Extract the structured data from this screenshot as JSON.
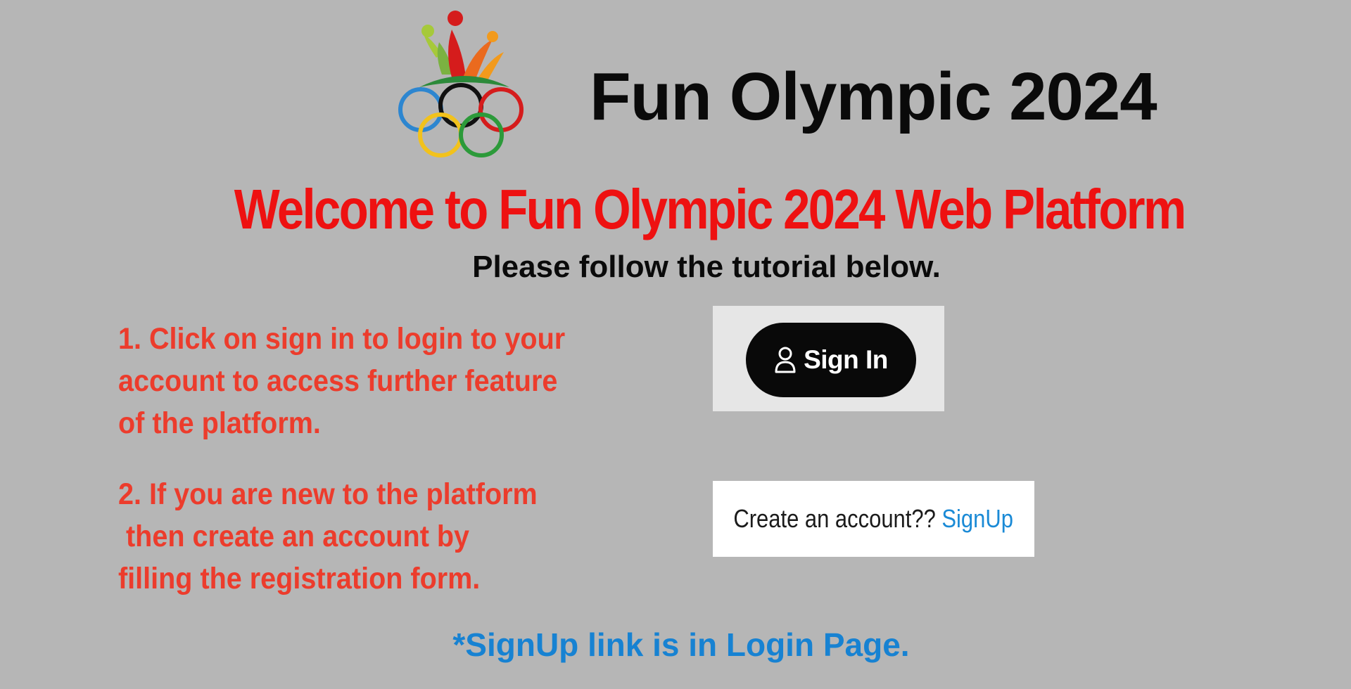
{
  "header": {
    "logo_icon": "olympic-rings-people-logo",
    "title": "Fun Olympic 2024"
  },
  "welcome": {
    "heading": "Welcome to Fun Olympic 2024 Web Platform",
    "subheading": "Please follow the tutorial below."
  },
  "steps": [
    {
      "text": "1. Click on sign in to login to your\naccount to access further feature\nof the platform."
    },
    {
      "text": "2. If you are new to the platform\n then create an account by\nfilling the registration form."
    }
  ],
  "signin_example": {
    "icon": "user-icon",
    "label": "Sign In"
  },
  "signup_example": {
    "prompt": "Create an account?? ",
    "link_label": "SignUp"
  },
  "note": "*SignUp link is in Login Page.",
  "colors": {
    "background": "#b6b6b6",
    "heading_red": "#ee1111",
    "step_red": "#ec3c2c",
    "link_blue": "#1a8ad6",
    "note_blue": "#1782d2"
  }
}
